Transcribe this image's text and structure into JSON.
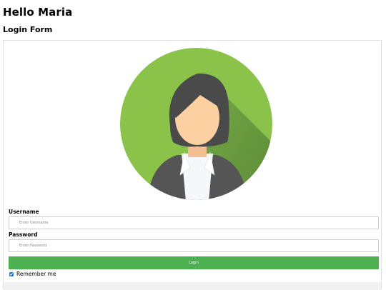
{
  "page": {
    "greeting": "Hello Maria",
    "form_title": "Login Form"
  },
  "avatar": {
    "icon": "female-user-avatar-icon",
    "colors": {
      "circle": "#8bc34a",
      "shadow": "#5a8a3a",
      "hair": "#4a4a4a",
      "skin": "#fcd0a1",
      "jacket": "#555555",
      "shirt": "#f5f7fa"
    }
  },
  "form": {
    "username_label": "Username",
    "username_placeholder": "Enter Username",
    "username_value": "",
    "password_label": "Password",
    "password_placeholder": "Enter Password",
    "password_value": "",
    "login_button": "Login",
    "remember_label": "Remember me",
    "remember_checked": true
  },
  "colors": {
    "accent": "#4caf50",
    "border": "#e2e2e2",
    "footer_bg": "#f1f1f1"
  }
}
